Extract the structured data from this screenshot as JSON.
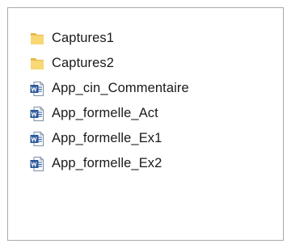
{
  "files": [
    {
      "name": "Captures1",
      "type": "folder",
      "icon": "folder-icon"
    },
    {
      "name": "Captures2",
      "type": "folder",
      "icon": "folder-icon"
    },
    {
      "name": "App_cin_Commentaire",
      "type": "word-document",
      "icon": "word-document-icon"
    },
    {
      "name": "App_formelle_Act",
      "type": "word-document",
      "icon": "word-document-icon"
    },
    {
      "name": "App_formelle_Ex1",
      "type": "word-document",
      "icon": "word-document-icon"
    },
    {
      "name": "App_formelle_Ex2",
      "type": "word-document",
      "icon": "word-document-icon"
    }
  ],
  "colors": {
    "folder_front": "#f8d775",
    "folder_back": "#e7b94d",
    "word_blue": "#2b579a",
    "border": "#a9a9a9"
  }
}
